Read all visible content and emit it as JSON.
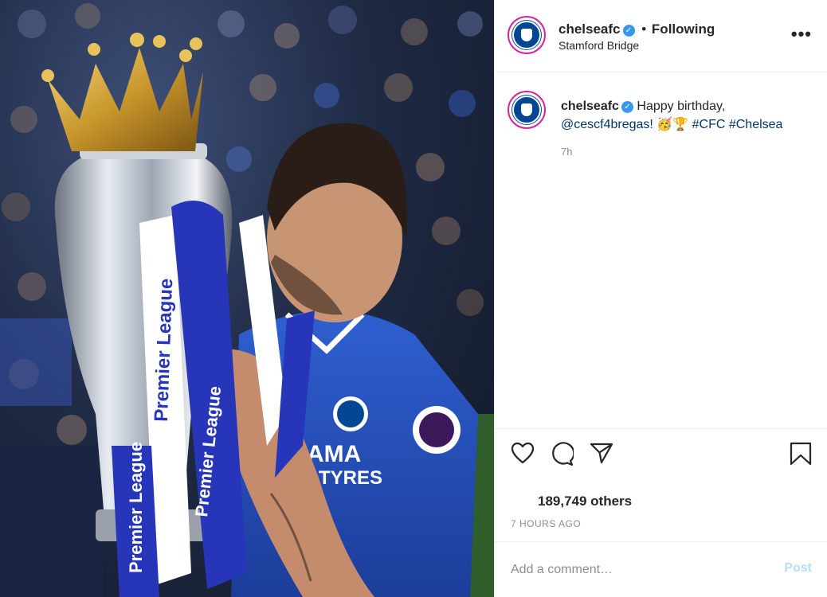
{
  "photo": {
    "alt": "",
    "ribbon_text": "Premier League",
    "sponsor_text_1": "AMA",
    "sponsor_text_2": "TYRES"
  },
  "header": {
    "username": "chelseafc",
    "verified_glyph": "✓",
    "separator": "•",
    "follow_status": "Following",
    "location": "Stamford Bridge",
    "more_glyph": "•••"
  },
  "caption": {
    "username": "chelseafc",
    "text_part1": "Happy birthday,",
    "mention": "@cescf4bregas!",
    "emojis": "🥳🏆",
    "hashtag1": "#CFC",
    "hashtag2": "#Chelsea",
    "time": "7h"
  },
  "actions": {
    "like_icon": "heart-icon",
    "comment_icon": "comment-icon",
    "share_icon": "paper-plane-icon",
    "save_icon": "bookmark-icon"
  },
  "likes": "189,749 others",
  "post_time": "7 HOURS AGO",
  "comment": {
    "placeholder": "Add a comment…",
    "value": "",
    "post_label": "Post"
  },
  "colors": {
    "chelsea_blue": "#034694",
    "link": "#00376b",
    "post_disabled": "#b2dffc",
    "verified": "#3897f0"
  }
}
